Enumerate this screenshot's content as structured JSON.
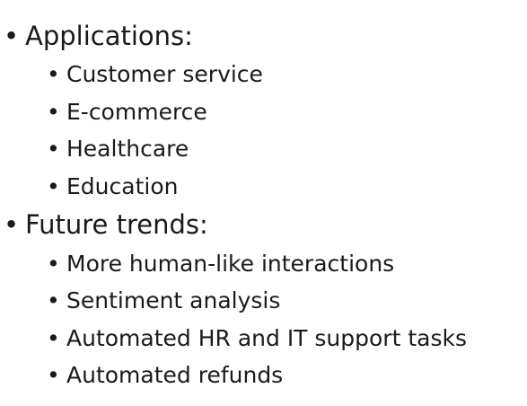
{
  "bullet_glyph": "•",
  "sections": [
    {
      "heading": "Applications:",
      "items": [
        "Customer service",
        "E-commerce",
        "Healthcare",
        "Education"
      ]
    },
    {
      "heading": "Future trends:",
      "items": [
        "More human-like interactions",
        "Sentiment analysis",
        "Automated HR and IT support tasks",
        "Automated refunds"
      ]
    }
  ]
}
